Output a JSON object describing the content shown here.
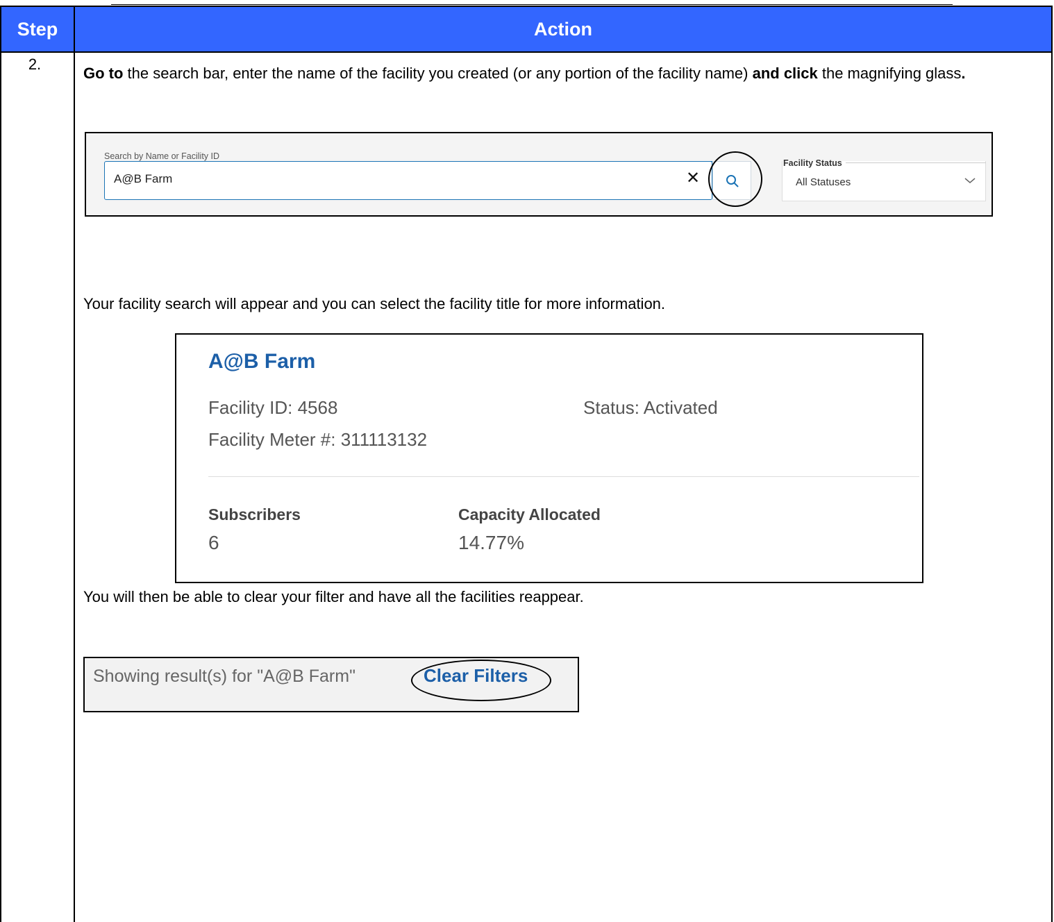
{
  "table": {
    "header": {
      "step": "Step",
      "action": "Action"
    },
    "step_number": "2.",
    "instruction": {
      "go_to": "Go to",
      "middle": " the search bar, enter the name of the facility you created (or any portion of the facility name) ",
      "and_click": "and click",
      "end": " the magnifying glass",
      "period": "."
    },
    "result_text": "Your facility search will appear and you can select the facility title for more information.",
    "clear_text": "You will then be able to clear your filter and have all the facilities reappear."
  },
  "search_screenshot": {
    "search_label": "Search by Name or Facility ID",
    "search_value": "A@B Farm",
    "clear_icon": "close-icon",
    "search_icon": "search-icon",
    "status_label": "Facility Status",
    "status_value": "All Statuses"
  },
  "facility_card": {
    "title": "A@B Farm",
    "facility_id": "Facility ID: 4568",
    "status": "Status: Activated",
    "meter": "Facility Meter #: 311113132",
    "subscribers_label": "Subscribers",
    "subscribers_value": "6",
    "capacity_label": "Capacity Allocated",
    "capacity_value": "14.77%"
  },
  "filter_bar": {
    "showing_text": "Showing result(s) for \"A@B Farm\"",
    "clear_filters": "Clear Filters"
  },
  "colors": {
    "header_bg": "#3366ff",
    "link_blue": "#1c5fa8"
  }
}
